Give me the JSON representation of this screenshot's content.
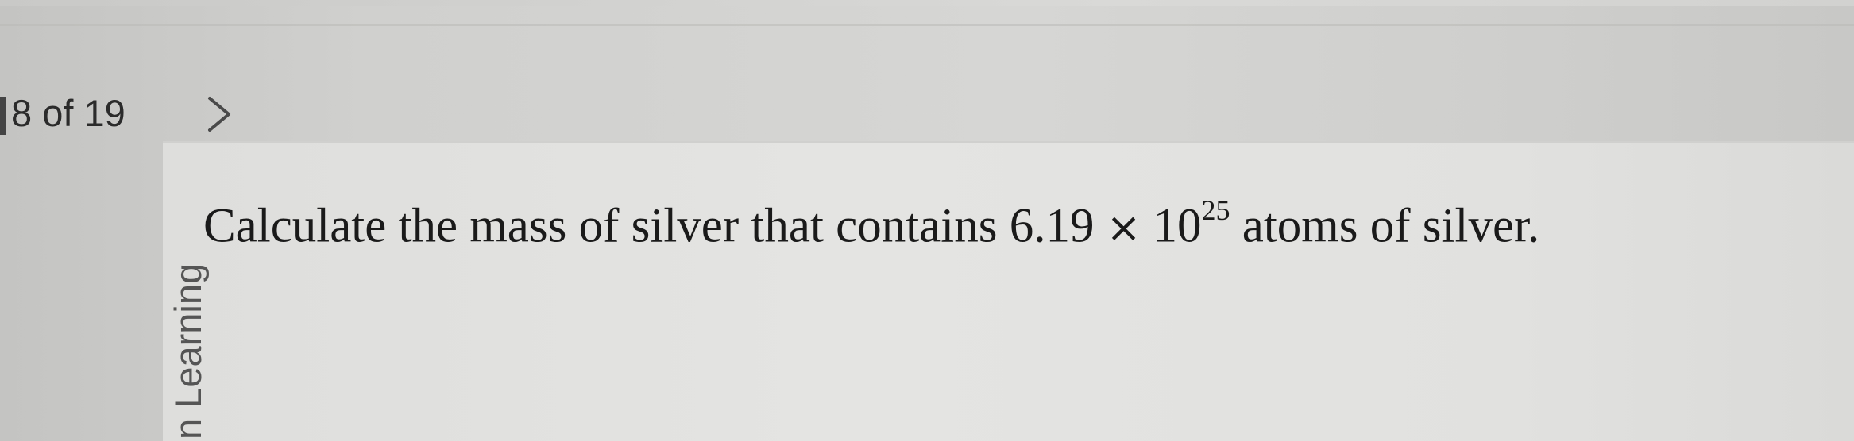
{
  "nav": {
    "counter_text": "8 of 19",
    "next_icon": "chevron-right-icon"
  },
  "sidebar": {
    "vertical_label": "n Learning"
  },
  "question": {
    "prefix": "Calculate the mass of silver that contains ",
    "mantissa": "6.19",
    "times_symbol": "×",
    "base": "10",
    "exponent": "25",
    "suffix": " atoms of silver."
  },
  "colors": {
    "background": "#d0d0ce",
    "panel": "#e2e2e0",
    "text": "#1a1a1a"
  }
}
